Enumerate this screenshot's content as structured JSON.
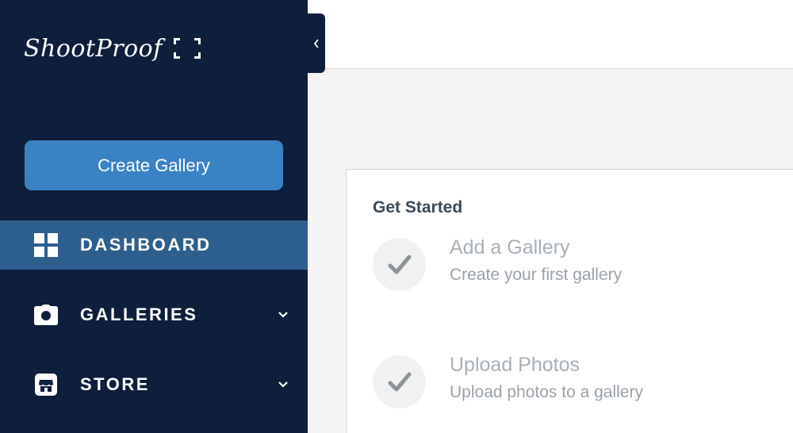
{
  "brand": {
    "logo_text": "ShootProof"
  },
  "sidebar": {
    "create_button_label": "Create Gallery",
    "items": [
      {
        "label": "DASHBOARD",
        "icon": "grid-icon",
        "active": true
      },
      {
        "label": "GALLERIES",
        "icon": "camera-icon",
        "active": false
      },
      {
        "label": "STORE",
        "icon": "storefront-icon",
        "active": false
      }
    ]
  },
  "card": {
    "title": "Get Started",
    "tasks": [
      {
        "title": "Add a Gallery",
        "subtitle": "Create your first gallery"
      },
      {
        "title": "Upload Photos",
        "subtitle": "Upload photos to a gallery"
      }
    ]
  },
  "colors": {
    "sidebar_bg": "#0d1f3c",
    "active_item_bg": "#2c5f8e",
    "primary_button": "#3b82c4",
    "page_bg": "#f4f4f4"
  }
}
